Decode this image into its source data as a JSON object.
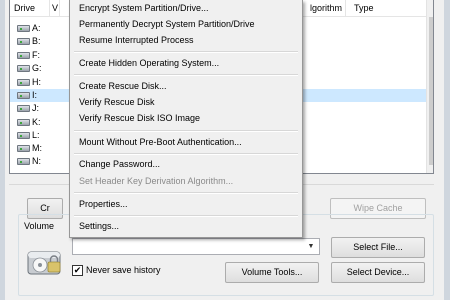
{
  "listview": {
    "columns": {
      "drive": "Drive",
      "volume": "V",
      "algorithm": "lgorithm",
      "type": "Type"
    },
    "drives": [
      {
        "label": "A:",
        "selected": false
      },
      {
        "label": "B:",
        "selected": false
      },
      {
        "label": "F:",
        "selected": false
      },
      {
        "label": "G:",
        "selected": false
      },
      {
        "label": "H:",
        "selected": false
      },
      {
        "label": "I:",
        "selected": true
      },
      {
        "label": "J:",
        "selected": false
      },
      {
        "label": "K:",
        "selected": false
      },
      {
        "label": "L:",
        "selected": false
      },
      {
        "label": "M:",
        "selected": false
      },
      {
        "label": "N:",
        "selected": false
      }
    ]
  },
  "menu": {
    "items": [
      {
        "label": "Encrypt System Partition/Drive...",
        "enabled": true
      },
      {
        "label": "Permanently Decrypt System Partition/Drive",
        "enabled": true
      },
      {
        "label": "Resume Interrupted Process",
        "enabled": true
      },
      {
        "label": "Create Hidden Operating System...",
        "enabled": true
      },
      {
        "label": "Create Rescue Disk...",
        "enabled": true
      },
      {
        "label": "Verify Rescue Disk",
        "enabled": true
      },
      {
        "label": "Verify Rescue Disk ISO Image",
        "enabled": true
      },
      {
        "label": "Mount Without Pre-Boot Authentication...",
        "enabled": true
      },
      {
        "label": "Change Password...",
        "enabled": true
      },
      {
        "label": "Set Header Key Derivation Algorithm...",
        "enabled": false
      },
      {
        "label": "Properties...",
        "enabled": true
      },
      {
        "label": "Settings...",
        "enabled": true
      }
    ]
  },
  "buttons": {
    "create_partial": "Cr",
    "wipe_cache": "Wipe Cache",
    "select_file": "Select File...",
    "volume_tools": "Volume Tools...",
    "select_device": "Select Device..."
  },
  "volume_group": {
    "legend": "Volume",
    "path_value": "",
    "never_save_history": "Never save history",
    "never_save_history_checked": true
  },
  "colors": {
    "selected_row": "#cde8ff",
    "window_bg": "#f0f0f0"
  }
}
